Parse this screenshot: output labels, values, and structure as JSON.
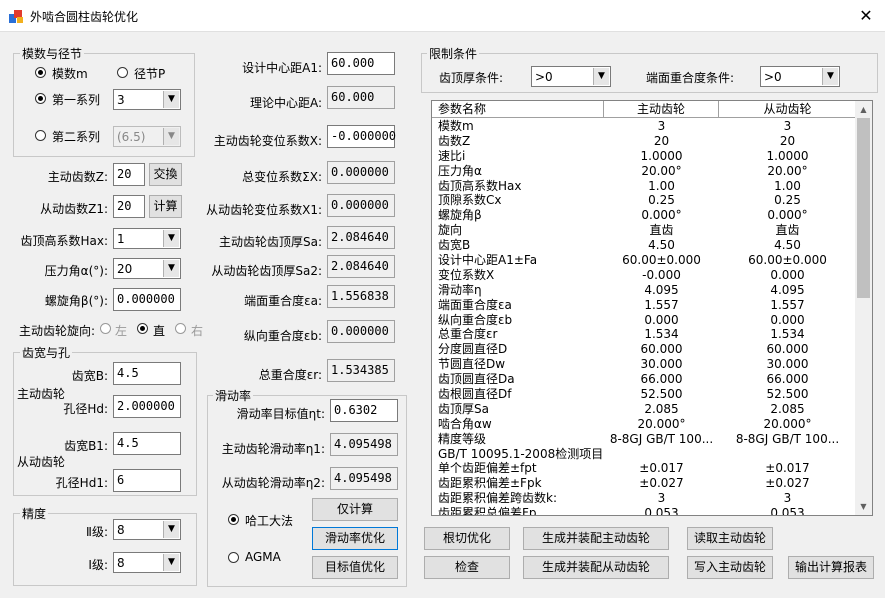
{
  "window": {
    "title": "外啮合圆柱齿轮优化",
    "close": "✕"
  },
  "module_group": {
    "legend": "模数与径节",
    "radio_module": "模数m",
    "radio_pitch": "径节P",
    "radio_series1": "第一系列",
    "series1_value": "3",
    "radio_series2": "第二系列",
    "series2_value": "(6.5)"
  },
  "left_fields": {
    "z_label": "主动齿数Z:",
    "z_value": "20",
    "swap_button": "交換",
    "z1_label": "从动齿数Z1:",
    "z1_value": "20",
    "calc_button": "计算",
    "hax_label": "齿顶高系数Hax:",
    "hax_value": "1",
    "alpha_label": "压力角α(°):",
    "alpha_value": "20",
    "beta_label": "螺旋角β(°):",
    "beta_value": "0.000000",
    "rotation_label": "主动齿轮旋向:",
    "rot_left": "左",
    "rot_straight": "直",
    "rot_right": "右"
  },
  "width_group": {
    "legend": "齿宽与孔",
    "b_label": "齿宽B:",
    "b_value": "4.5",
    "driver_label": "主动齿轮",
    "hd_label": "孔径Hd:",
    "hd_value": "2.000000",
    "b1_label": "齿宽B1:",
    "b1_value": "4.5",
    "driven_label": "从动齿轮",
    "hd1_label": "孔径Hd1:",
    "hd1_value": "6"
  },
  "precision_group": {
    "legend": "精度",
    "level2_label": "Ⅱ级:",
    "level2_value": "8",
    "level1_label": "Ⅰ级:",
    "level1_value": "8"
  },
  "middle_fields": {
    "a1_label": "设计中心距A1:",
    "a1_value": "60.000",
    "a_label": "理论中心距A:",
    "a_value": "60.000",
    "x_label": "主动齿轮变位系数X:",
    "x_value": "-0.000000",
    "sum_label": "总变位系数ΣX:",
    "sum_value": "0.000000",
    "x1_label": "从动齿轮变位系数X1:",
    "x1_value": "0.000000",
    "sa_label": "主动齿轮齿顶厚Sa:",
    "sa_value": "2.084640",
    "sa2_label": "从动齿轮齿顶厚Sa2:",
    "sa2_value": "2.084640",
    "ea_label": "端面重合度εa:",
    "ea_value": "1.556838",
    "eb_label": "纵向重合度εb:",
    "eb_value": "0.000000",
    "er_label": "总重合度εr:",
    "er_value": "1.534385"
  },
  "slip_group": {
    "legend": "滑动率",
    "target_label": "滑动率目标值ηt:",
    "target_value": "0.6302",
    "eta1_label": "主动齿轮滑动率η1:",
    "eta1_value": "4.095498",
    "eta2_label": "从动齿轮滑动率η2:",
    "eta2_value": "4.095498",
    "radio_hit": "哈工大法",
    "radio_agma": "AGMA",
    "btn_calc_only": "仅计算",
    "btn_slip_opt": "滑动率优化",
    "btn_target_opt": "目标值优化"
  },
  "constraints": {
    "legend": "限制条件",
    "top_label": "齿顶厚条件:",
    "top_value": ">0",
    "end_label": "端面重合度条件:",
    "end_value": ">0"
  },
  "grid": {
    "headers": [
      "参数名称",
      "主动齿轮",
      "从动齿轮"
    ],
    "rows": [
      [
        "模数m",
        "3",
        "3"
      ],
      [
        "齿数Z",
        "20",
        "20"
      ],
      [
        "速比i",
        "1.0000",
        "1.0000"
      ],
      [
        "压力角α",
        "20.00°",
        "20.00°"
      ],
      [
        "齿顶高系数Hax",
        "1.00",
        "1.00"
      ],
      [
        "顶隙系数Cx",
        "0.25",
        "0.25"
      ],
      [
        "螺旋角β",
        "0.000°",
        "0.000°"
      ],
      [
        "旋向",
        "直齿",
        "直齿"
      ],
      [
        "齿宽B",
        "4.50",
        "4.50"
      ],
      [
        "设计中心距A1±Fa",
        "60.00±0.000",
        "60.00±0.000"
      ],
      [
        "变位系数X",
        "-0.000",
        "0.000"
      ],
      [
        "滑动率η",
        "4.095",
        "4.095"
      ],
      [
        "端面重合度εa",
        "1.557",
        "1.557"
      ],
      [
        "纵向重合度εb",
        "0.000",
        "0.000"
      ],
      [
        "总重合度εr",
        "1.534",
        "1.534"
      ],
      [
        "分度圆直径D",
        "60.000",
        "60.000"
      ],
      [
        "节圆直径Dw",
        "30.000",
        "30.000"
      ],
      [
        "齿顶圆直径Da",
        "66.000",
        "66.000"
      ],
      [
        "齿根圆直径Df",
        "52.500",
        "52.500"
      ],
      [
        "齿顶厚Sa",
        "2.085",
        "2.085"
      ],
      [
        "啮合角αw",
        "20.000°",
        "20.000°"
      ],
      [
        "精度等级",
        "8-8GJ GB/T 100...",
        "8-8GJ GB/T 100..."
      ],
      [
        "GB/T 10095.1-2008检测项目",
        "",
        ""
      ],
      [
        "单个齿距偏差±fpt",
        "±0.017",
        "±0.017"
      ],
      [
        "齿距累积偏差±Fpk",
        "±0.027",
        "±0.027"
      ],
      [
        "齿距累积偏差跨齿数k:",
        "3",
        "3"
      ],
      [
        "齿距累积总偏差Fp",
        "0.053",
        "0.053"
      ]
    ]
  },
  "bottom_buttons": {
    "undercut": "根切优化",
    "gen_driver": "生成并装配主动齿轮",
    "read_driver": "读取主动齿轮",
    "check": "检查",
    "gen_driven": "生成并装配从动齿轮",
    "write_driver": "写入主动齿轮",
    "report": "输出计算报表"
  }
}
